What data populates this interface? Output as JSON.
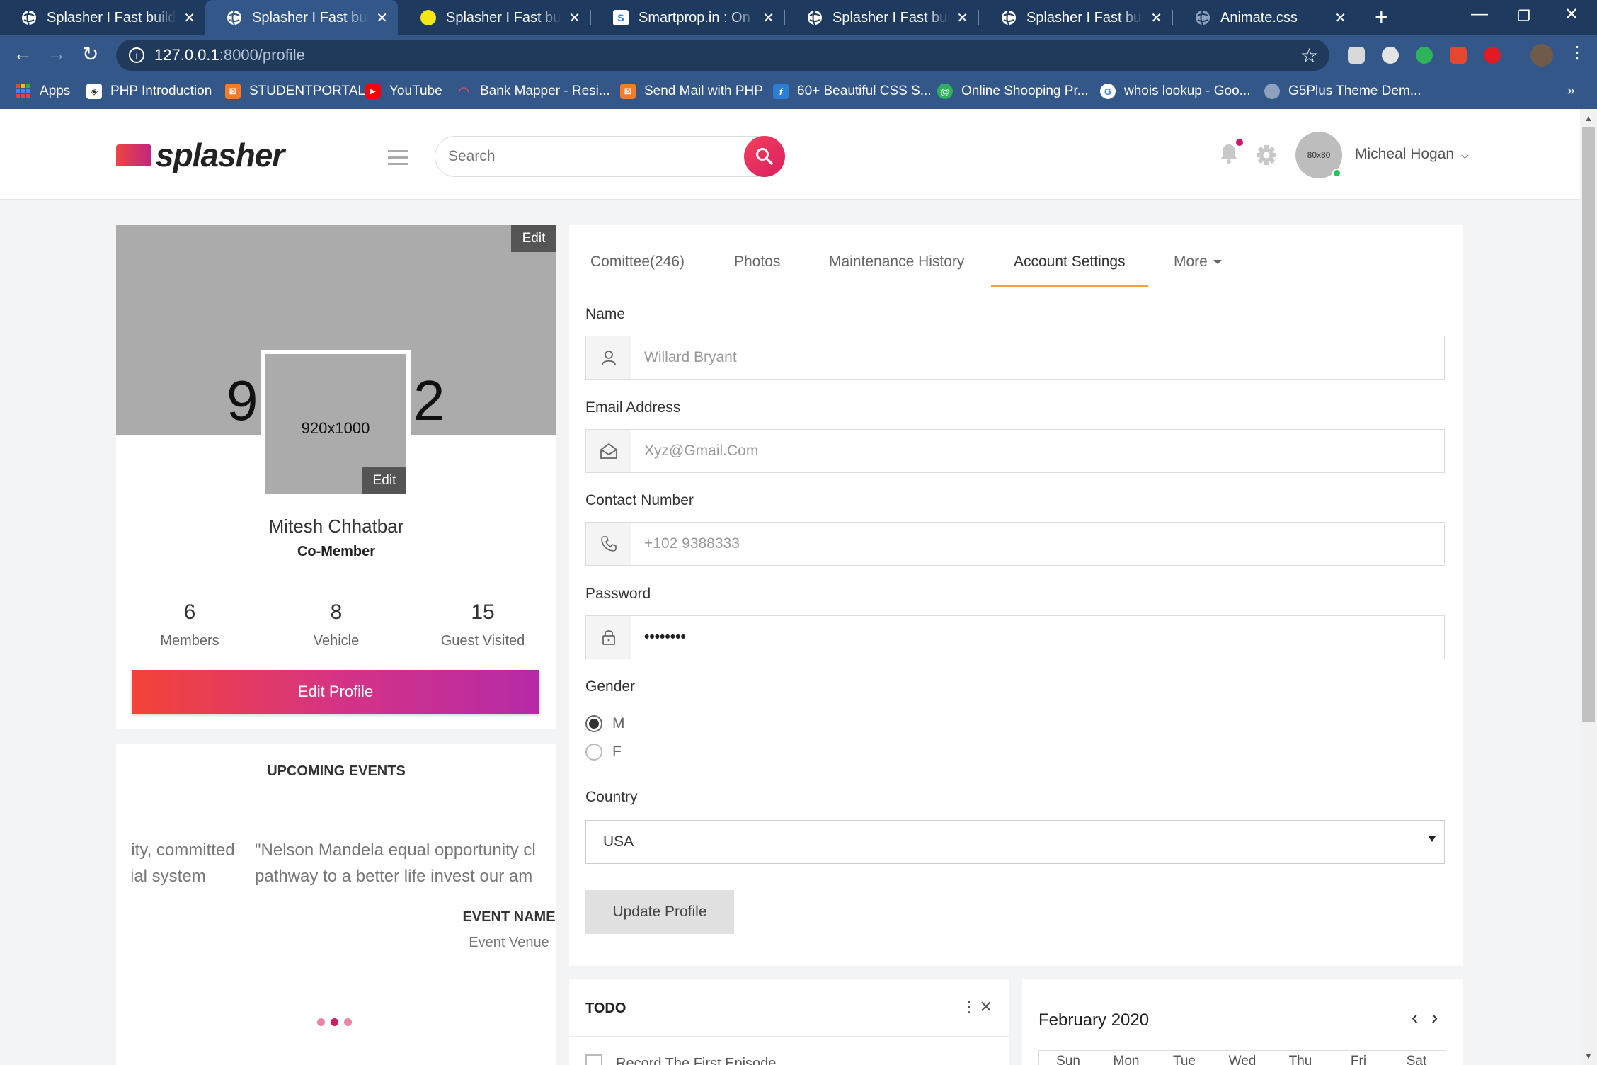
{
  "browser": {
    "tabs": [
      {
        "title": "Splasher I Fast build Admin Template",
        "icon": "globe-icon",
        "active": false
      },
      {
        "title": "Splasher I Fast build Admin Template",
        "icon": "globe-icon",
        "active": true
      },
      {
        "title": "Splasher I Fast build Admin Template",
        "icon": "yellow-circle-icon",
        "active": false
      },
      {
        "title": "Smartprop.in : On Demand",
        "icon": "smartprop-icon",
        "active": false
      },
      {
        "title": "Splasher I Fast build Admin Template",
        "icon": "globe-icon",
        "active": false
      },
      {
        "title": "Splasher I Fast build Admin Template",
        "icon": "globe-icon",
        "active": false
      },
      {
        "title": "Animate.css",
        "icon": "globe-icon",
        "active": false
      }
    ],
    "new_tab": "+",
    "url_host": "127.0.0.1",
    "url_path": ":8000/profile",
    "bookmarks": [
      {
        "label": "Apps",
        "icon": "apps-grid-icon"
      },
      {
        "label": "PHP Introduction",
        "icon": "w3-icon"
      },
      {
        "label": "STUDENTPORTAL",
        "icon": "xampp-icon"
      },
      {
        "label": "YouTube",
        "icon": "youtube-icon"
      },
      {
        "label": "Bank Mapper - Resi...",
        "icon": "bankmapper-icon"
      },
      {
        "label": "Send Mail with PHP",
        "icon": "xampp-icon"
      },
      {
        "label": "60+ Beautiful CSS S...",
        "icon": "f-icon"
      },
      {
        "label": "Online Shooping Pr...",
        "icon": "spiral-icon"
      },
      {
        "label": "whois lookup - Goo...",
        "icon": "google-icon"
      },
      {
        "label": "G5Plus Theme Dem...",
        "icon": "globe-icon"
      }
    ],
    "more_bookmarks": "»"
  },
  "header": {
    "logo_text": "splasher",
    "search_placeholder": "Search",
    "avatar_text": "80x80",
    "user_name": "Micheal Hogan"
  },
  "profile": {
    "cover_edit": "Edit",
    "cover_left_num": "9",
    "cover_right_num": "2",
    "photo_text": "920x1000",
    "photo_edit": "Edit",
    "name": "Mitesh Chhatbar",
    "role": "Co-Member",
    "stats": [
      {
        "value": "6",
        "label": "Members"
      },
      {
        "value": "8",
        "label": "Vehicle"
      },
      {
        "value": "15",
        "label": "Guest Visited"
      }
    ],
    "edit_button": "Edit Profile"
  },
  "events": {
    "title": "UPCOMING EVENTS",
    "quote_left_1": "nity, committed",
    "quote_left_2": "cial system",
    "quote_right_1": "\"Nelson Mandela equal opportunity cl",
    "quote_right_2": "pathway to a better life invest our am",
    "event_name": "EVENT NAME",
    "event_venue": "Event Venue"
  },
  "settings": {
    "tabs": [
      "Comittee(246)",
      "Photos",
      "Maintenance History",
      "Account Settings",
      "More"
    ],
    "active_tab": "Account Settings",
    "name_label": "Name",
    "name_placeholder": "Willard Bryant",
    "email_label": "Email Address",
    "email_placeholder": "Xyz@Gmail.Com",
    "contact_label": "Contact Number",
    "contact_placeholder": "+102 9388333",
    "password_label": "Password",
    "password_value": "••••••••",
    "gender_label": "Gender",
    "gender_options": [
      "M",
      "F"
    ],
    "gender_selected": "M",
    "country_label": "Country",
    "country_value": "USA",
    "update_button": "Update Profile"
  },
  "todo": {
    "title": "TODO",
    "first_item": "Record The First Episode"
  },
  "calendar": {
    "title": "February 2020",
    "days": [
      "Sun",
      "Mon",
      "Tue",
      "Wed",
      "Thu",
      "Fri",
      "Sat"
    ]
  },
  "colors": {
    "chrome_dark": "#1f3a5f",
    "chrome_light": "#34578a",
    "accent_orange": "#f59e42",
    "brand_gradient_start": "#f44336",
    "brand_gradient_end": "#b52aa8",
    "search_button": "#e8245f"
  }
}
